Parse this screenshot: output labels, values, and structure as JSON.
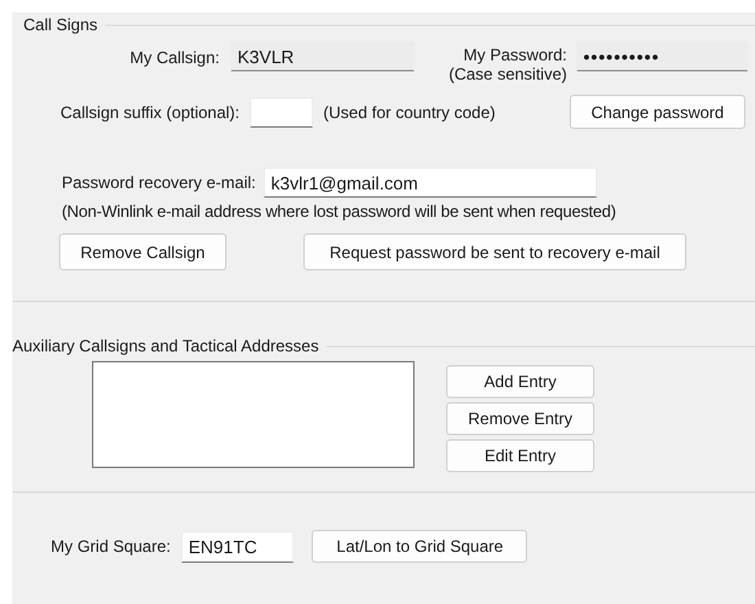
{
  "call_signs": {
    "title": "Call Signs",
    "callsign": {
      "label": "My Callsign:",
      "value": "K3VLR",
      "readonly": true
    },
    "password": {
      "label": "My Password:",
      "note": "(Case sensitive)",
      "value": "••••••••••",
      "readonly": true
    },
    "suffix": {
      "label": "Callsign suffix (optional):",
      "note": "(Used for country code)",
      "readonly": false
    },
    "change_password_button": "Change password",
    "recovery_email": {
      "label": "Password recovery e-mail:",
      "value": "k3vlr1@gmail.com",
      "readonly": false
    },
    "recovery_note": "(Non-Winlink e-mail address where lost password will be sent when requested)",
    "buttons": [
      "Remove Callsign",
      "Request password be sent to recovery e-mail"
    ]
  },
  "auxiliary": {
    "title": "Auxiliary Callsigns and Tactical Addresses",
    "buttons": [
      "Add Entry",
      "Remove Entry",
      "Edit Entry"
    ]
  },
  "grid_square": {
    "label": "My Grid Square:",
    "value": "EN91TC",
    "readonly": false,
    "button": "Lat/Lon to Grid Square"
  }
}
